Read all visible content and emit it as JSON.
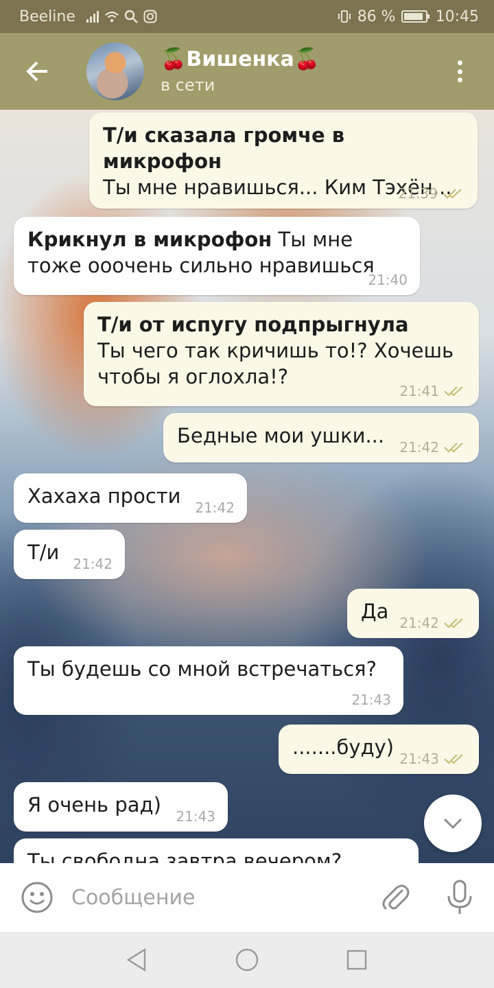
{
  "status_bar": {
    "carrier": "Beeline",
    "battery": "86 %",
    "time": "10:45"
  },
  "header": {
    "chat_name": "Вишенка",
    "cherry_emoji": "🍒",
    "status": "в сети"
  },
  "messages": [
    {
      "dir": "out",
      "bold": "Т/и сказала громче в микрофон",
      "text": "Ты мне нравишься... Ким Тэхён...",
      "time": "21:39",
      "read": true
    },
    {
      "dir": "in",
      "bold": "Крикнул в микрофон",
      "text": "Ты мне тоже ооочень сильно нравишься",
      "time": "21:40"
    },
    {
      "dir": "out",
      "bold": "Т/и от испугу подпрыгнула",
      "text": "Ты чего так кричишь то!? Хочешь чтобы я оглохла!?",
      "time": "21:41",
      "read": true
    },
    {
      "dir": "out",
      "text": "Бедные мои ушки...",
      "time": "21:42",
      "read": true
    },
    {
      "dir": "in",
      "text": "Хахаха прости",
      "time": "21:42"
    },
    {
      "dir": "in",
      "text": "Т/и",
      "time": "21:42"
    },
    {
      "dir": "out",
      "text": "Да",
      "time": "21:42",
      "read": true
    },
    {
      "dir": "in",
      "text": "Ты будешь со мной встречаться?",
      "time": "21:43"
    },
    {
      "dir": "out",
      "text": ".......буду)",
      "time": "21:43",
      "read": true
    },
    {
      "dir": "in",
      "text": "Я очень рад)",
      "time": "21:43"
    },
    {
      "dir": "in",
      "text": "Ты свободна завтра вечером?",
      "time": ""
    }
  ],
  "input": {
    "placeholder": "Сообщение"
  },
  "icons": {
    "back": "arrow-left-icon",
    "menu": "more-vertical-icon",
    "read": "double-check-icon",
    "scroll_down": "chevron-down-icon",
    "emoji": "smiley-icon",
    "attach": "paperclip-icon",
    "mic": "microphone-icon"
  },
  "colors": {
    "status_bar": "#7d7350",
    "header": "#a19c6b",
    "outgoing_bubble": "#fbf8e8",
    "incoming_bubble": "#ffffff",
    "read_check": "#c7bd7a"
  }
}
